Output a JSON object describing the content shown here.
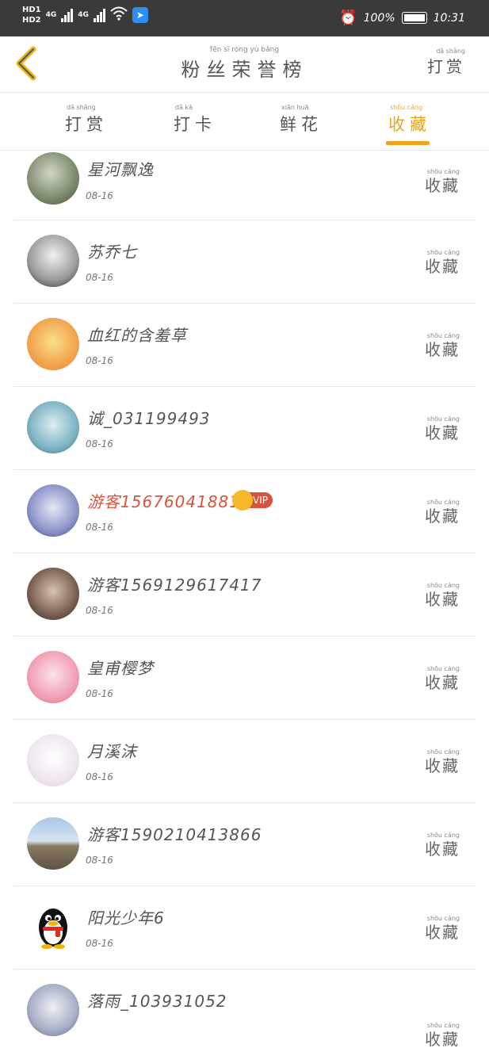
{
  "status_bar": {
    "hd1": "HD1",
    "hd2": "HD2",
    "net1": "4G",
    "net2": "4G",
    "battery": "100%",
    "time": "10:31",
    "icons": [
      "signal-icon",
      "wifi-icon",
      "app-icon",
      "alarm-icon",
      "battery-icon"
    ]
  },
  "header": {
    "title": "粉丝荣誉榜",
    "title_pinyin": "fěn sī róng yù bǎng",
    "right_label": "打赏",
    "right_pinyin": "dǎ shǎng"
  },
  "tabs": [
    {
      "label": "打赏",
      "pinyin": "dǎ shǎng",
      "active": false
    },
    {
      "label": "打卡",
      "pinyin": "dǎ kǎ",
      "active": false
    },
    {
      "label": "鲜花",
      "pinyin": "xiān huā",
      "active": false
    },
    {
      "label": "收藏",
      "pinyin": "shōu cáng",
      "active": true
    }
  ],
  "accent_color": "#f0a21c",
  "vip_color": "#d9533a",
  "action_label": "收藏",
  "action_pinyin": "shōu cáng",
  "rows": [
    {
      "name": "星河飘逸",
      "date": "08-16",
      "vip": false
    },
    {
      "name": "苏乔七",
      "date": "08-16",
      "vip": false
    },
    {
      "name": "血红的含羞草",
      "date": "08-16",
      "vip": false
    },
    {
      "name": "诚_031199493",
      "date": "08-16",
      "vip": false
    },
    {
      "name": "游客15676041881​56",
      "date": "08-16",
      "vip": true,
      "badge": "VIP"
    },
    {
      "name": "游客15691296174​17",
      "date": "08-16",
      "vip": false
    },
    {
      "name": "皇甫樱梦",
      "date": "08-16",
      "vip": false
    },
    {
      "name": "月溪沫",
      "date": "08-16",
      "vip": false
    },
    {
      "name": "游客15902104138​66",
      "date": "08-16",
      "vip": false
    },
    {
      "name": "阳光少年6",
      "date": "08-16",
      "vip": false
    },
    {
      "name": "落雨_103931052",
      "date": "",
      "vip": false
    }
  ]
}
